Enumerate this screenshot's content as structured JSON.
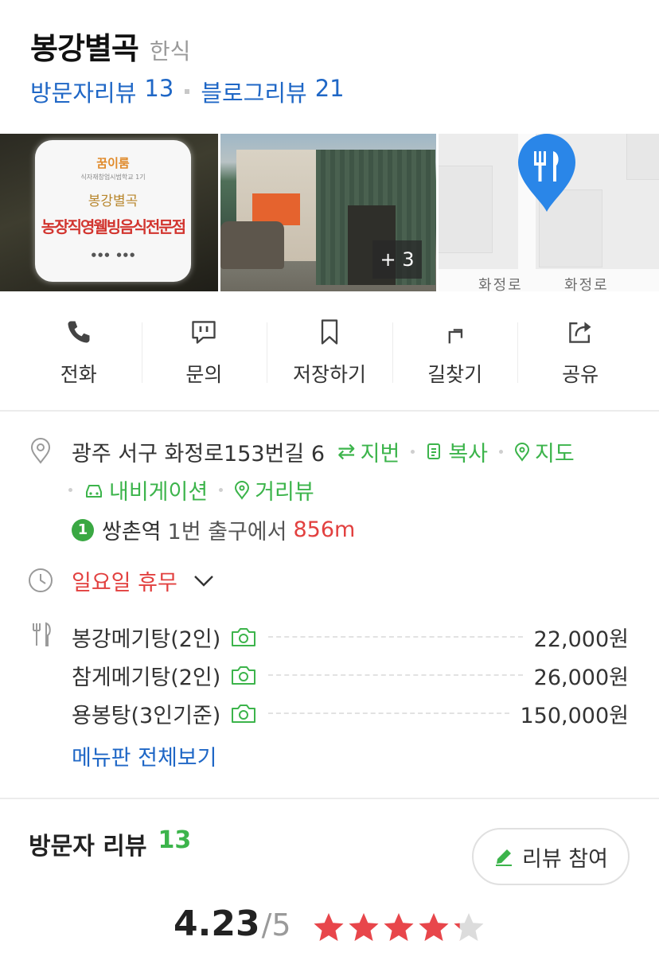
{
  "place": {
    "name": "봉강별곡",
    "category": "한식"
  },
  "reviews_links": {
    "visitor_label": "방문자리뷰",
    "visitor_count": "13",
    "blog_label": "블로그리뷰",
    "blog_count": "21"
  },
  "gallery": {
    "more_count": "+ 3",
    "sign_text": [
      "꿈이룸",
      "식자재창업시범학교 1기",
      "봉강별곡",
      "농장직영웰빙음식전문점"
    ],
    "map_labels": [
      "화정로",
      "화정로"
    ]
  },
  "actions": [
    {
      "label": "전화",
      "icon": "phone-icon"
    },
    {
      "label": "문의",
      "icon": "chat-icon"
    },
    {
      "label": "저장하기",
      "icon": "bookmark-icon"
    },
    {
      "label": "길찾기",
      "icon": "directions-icon"
    },
    {
      "label": "공유",
      "icon": "share-icon"
    }
  ],
  "address": {
    "text": "광주 서구 화정로153번길 6",
    "links": [
      "지번",
      "복사",
      "지도",
      "내비게이션",
      "거리뷰"
    ]
  },
  "subway": {
    "line": "1",
    "station": "쌍촌역",
    "exit": "1번 출구에서",
    "distance": "856m"
  },
  "hours": {
    "status": "일요일 휴무"
  },
  "menu": {
    "items": [
      {
        "name": "봉강메기탕(2인)",
        "price": "22,000원"
      },
      {
        "name": "참게메기탕(2인)",
        "price": "26,000원"
      },
      {
        "name": "용봉탕(3인기준)",
        "price": "150,000원"
      }
    ],
    "view_all": "메뉴판 전체보기"
  },
  "visitor_reviews": {
    "title": "방문자 리뷰",
    "count": "13",
    "write_button": "리뷰 참여",
    "score": "4.23",
    "score_max": "/5",
    "rating": 4.23
  },
  "colors": {
    "link_blue": "#1f67c6",
    "green": "#3cb44b",
    "red": "#e2403f",
    "star_red": "#e8464b",
    "pin_blue": "#2a86e8"
  }
}
